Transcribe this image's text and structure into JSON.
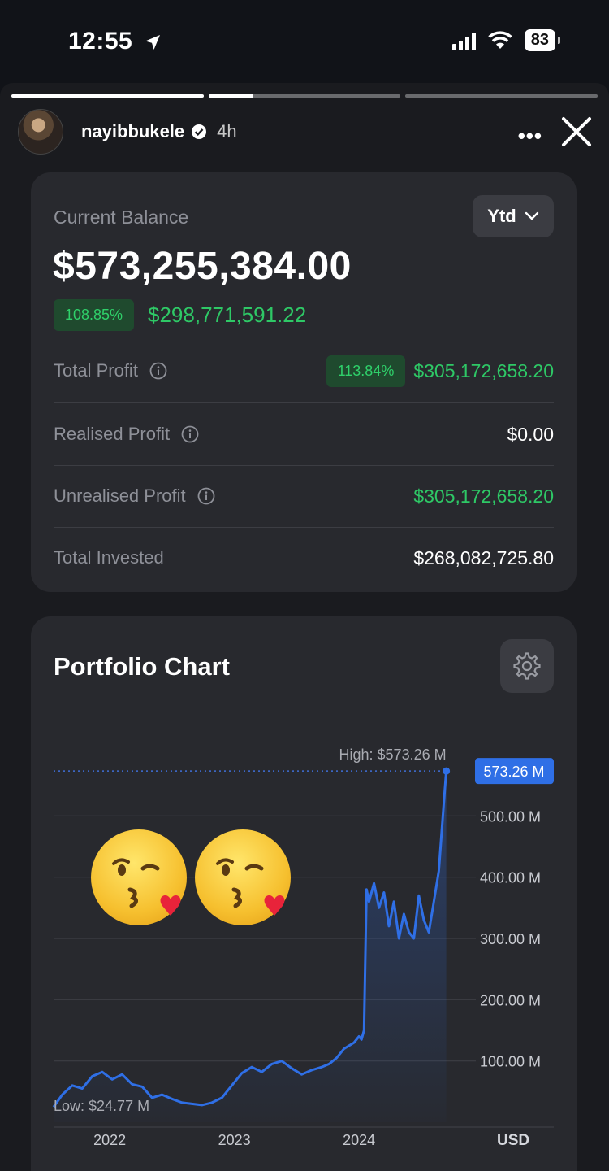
{
  "status_bar": {
    "time": "12:55",
    "battery": "83"
  },
  "story": {
    "progress": [
      1.0,
      0.23,
      0.0
    ],
    "username": "nayibbukele",
    "posted": "4h"
  },
  "balance": {
    "label": "Current Balance",
    "period": "Ytd",
    "value": "$573,255,384.00",
    "change_pct": "108.85%",
    "change_value": "$298,771,591.22",
    "rows": [
      {
        "label": "Total Profit",
        "pct": "113.84%",
        "value": "$305,172,658.20"
      },
      {
        "label": "Realised Profit",
        "value": "$0.00"
      },
      {
        "label": "Unrealised Profit",
        "value": "$305,172,658.20"
      },
      {
        "label": "Total Invested",
        "value": "$268,082,725.80"
      }
    ]
  },
  "chart": {
    "title": "Portfolio Chart",
    "high_label": "High: $573.26 M",
    "high_tag": "573.26 M",
    "low_label": "Low: $24.77 M",
    "currency": "USD",
    "accent": "#2f6fe6"
  },
  "chart_data": {
    "type": "area",
    "ylim": [
      0,
      600
    ],
    "y_ticks": [
      100,
      200,
      300,
      400,
      500
    ],
    "y_tick_labels": [
      "100.00 M",
      "200.00 M",
      "300.00 M",
      "400.00 M",
      "500.00 M"
    ],
    "x_tick_values": [
      2022.0,
      2023.0,
      2024.0
    ],
    "x_tick_labels": [
      "2022",
      "2023",
      "2024"
    ],
    "xlim": [
      2021.55,
      2024.95
    ],
    "high": 573.26,
    "low": 24.77,
    "x": [
      2021.55,
      2021.62,
      2021.7,
      2021.78,
      2021.86,
      2021.94,
      2022.02,
      2022.1,
      2022.18,
      2022.26,
      2022.34,
      2022.42,
      2022.5,
      2022.58,
      2022.66,
      2022.74,
      2022.82,
      2022.9,
      2022.98,
      2023.06,
      2023.14,
      2023.22,
      2023.3,
      2023.38,
      2023.46,
      2023.54,
      2023.62,
      2023.7,
      2023.76,
      2023.82,
      2023.88,
      2023.92,
      2023.96,
      2024.0,
      2024.02,
      2024.04,
      2024.06,
      2024.08,
      2024.12,
      2024.16,
      2024.2,
      2024.24,
      2024.28,
      2024.32,
      2024.36,
      2024.4,
      2024.44,
      2024.48,
      2024.52,
      2024.56,
      2024.6,
      2024.64,
      2024.68,
      2024.7
    ],
    "y": [
      24.77,
      45,
      60,
      55,
      75,
      82,
      70,
      78,
      62,
      58,
      40,
      45,
      38,
      32,
      30,
      28,
      32,
      40,
      60,
      80,
      90,
      82,
      95,
      100,
      88,
      78,
      85,
      90,
      95,
      105,
      120,
      125,
      130,
      140,
      135,
      150,
      380,
      360,
      390,
      350,
      375,
      320,
      360,
      300,
      340,
      310,
      300,
      370,
      330,
      310,
      360,
      410,
      520,
      573.26
    ]
  }
}
